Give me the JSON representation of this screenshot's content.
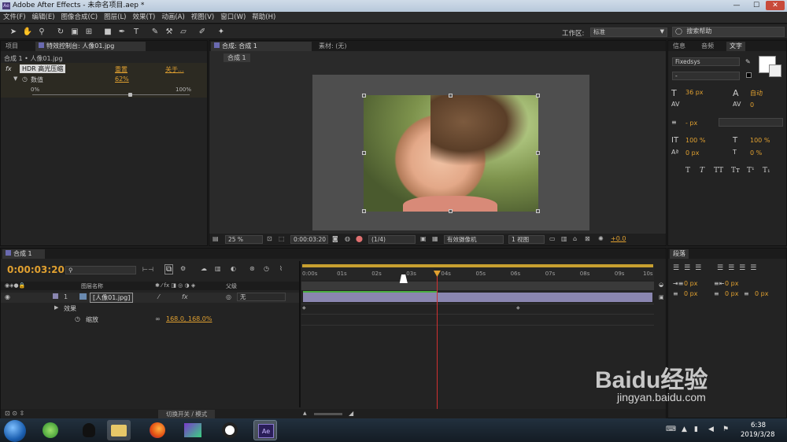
{
  "window": {
    "app_icon": "Ae",
    "title": "Adobe After Effects - 未命名项目.aep *",
    "min": "—",
    "max": "☐",
    "close": "✕"
  },
  "menu": [
    "文件(F)",
    "编辑(E)",
    "图像合成(C)",
    "图层(L)",
    "效果(T)",
    "动画(A)",
    "视图(V)",
    "窗口(W)",
    "帮助(H)"
  ],
  "toolbar": {
    "workspace_label": "工作区:",
    "workspace_value": "标准",
    "search_placeholder": "搜索帮助",
    "search_icon": "◯"
  },
  "effects_panel": {
    "tab_project": "项目",
    "tab_effects": "特效控制台: 人像01.jpg",
    "breadcrumb": "合成 1 • 人像01.jpg",
    "fx_label": "fx",
    "effect_name": "HDR 高光压缩",
    "reset": "重置",
    "about": "关于...",
    "param_name": "数值",
    "param_value": "62%",
    "slider_min": "0%",
    "slider_max": "100%",
    "slider_fraction": 0.62
  },
  "comp_panel": {
    "tab_comp": "合成: 合成 1",
    "tab_footage": "素材: (无)",
    "subtab": "合成 1",
    "zoom": "25 %",
    "timecode": "0:00:03:20",
    "resolution": "(1/4)",
    "camera": "有效摄像机",
    "views": "1 视图",
    "exposure": "+0.0"
  },
  "char_panel": {
    "tab_info": "信息",
    "tab_audio": "音频",
    "tab_text": "文字",
    "font": "Fixedsys",
    "style": "-",
    "size": "36 px",
    "leading": "自动",
    "kerning": "",
    "tracking": "0",
    "stroke": "- px",
    "vscale": "100 %",
    "hscale": "100 %",
    "baseline": "0 px",
    "tsume": "0 %",
    "styles": [
      "T",
      "T",
      "TT",
      "Tт",
      "T¹",
      "T₁"
    ]
  },
  "timeline": {
    "tab": "合成 1",
    "timecode": "0:00:03:20",
    "search_placeholder": "",
    "col_layer": "图层名称",
    "col_parent": "父级",
    "layer_num": "1",
    "layer_name": "[人像01.jpg]",
    "parent_value": "无",
    "effects_label": "效果",
    "scale_label": "缩放",
    "scale_value": "168.0, 168.0%",
    "ruler": [
      "0:00s",
      "01s",
      "02s",
      "03s",
      "04s",
      "05s",
      "06s",
      "07s",
      "08s",
      "09s",
      "10s"
    ],
    "footer_toggle": "切换开关 / 模式",
    "playhead_sec": 3.83,
    "duration_sec": 10
  },
  "paragraph_panel": {
    "tab": "段落",
    "indent_left": "0 px",
    "indent_right": "0 px",
    "indent_first": "0 px",
    "space_before": "0 px",
    "space_after": "0 px"
  },
  "watermark": {
    "brand": "Baidu经验",
    "url": "jingyan.baidu.com"
  },
  "taskbar": {
    "time": "6:38",
    "date": "2019/3/28"
  },
  "colors": {
    "accent": "#e0a030",
    "playhead": "#d03030",
    "layer_bar": "#8a86b0",
    "work_area": "#c8a030"
  }
}
